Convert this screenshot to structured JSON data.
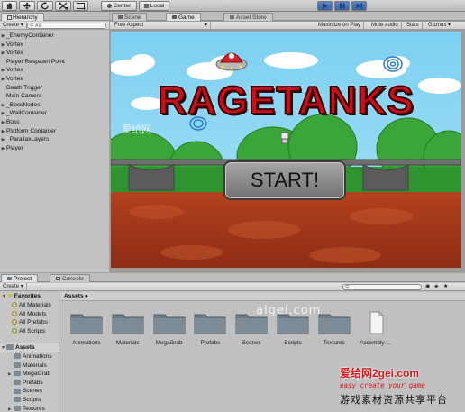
{
  "toolbar": {
    "pivot_label": "Center",
    "space_label": "Local"
  },
  "hierarchy": {
    "tab_label": "Hierarchy",
    "create_label": "Create",
    "search_placeholder": "All",
    "items": [
      {
        "label": "_EnemyContainer",
        "arrow": true
      },
      {
        "label": "Vortex",
        "arrow": true
      },
      {
        "label": "Vortex",
        "arrow": true
      },
      {
        "label": "Player Respawn Point",
        "arrow": false
      },
      {
        "label": "Vortex",
        "arrow": true
      },
      {
        "label": "Vortex",
        "arrow": true
      },
      {
        "label": "Death Trigger",
        "arrow": false
      },
      {
        "label": "Main Camera",
        "arrow": false
      },
      {
        "label": "_BossNodes",
        "arrow": true
      },
      {
        "label": "_WallContainer",
        "arrow": true
      },
      {
        "label": "Boss",
        "arrow": true
      },
      {
        "label": "Platform Container",
        "arrow": true
      },
      {
        "label": "_ParallaxLayers",
        "arrow": true
      },
      {
        "label": "Player",
        "arrow": true
      }
    ]
  },
  "center_tabs": {
    "scene": "Scene",
    "game": "Game",
    "asset_store": "Asset Store"
  },
  "game_bar": {
    "aspect": "Free Aspect",
    "maximize": "Maximize on Play",
    "mute": "Mute audio",
    "stats": "Stats",
    "gizmos": "Gizmos"
  },
  "game": {
    "logo": "RAGETANKS",
    "start_label": "START!",
    "watermark_small": "爱给网"
  },
  "project": {
    "tab_project": "Project",
    "tab_console": "Console",
    "create_label": "Create",
    "breadcrumb": "Assets",
    "favorites_label": "Favorites",
    "favorites": [
      "All Materials",
      "All Models",
      "All Prefabs",
      "All Scripts"
    ],
    "assets_label": "Assets",
    "tree": [
      "Animations",
      "Materials",
      "MegaGrab",
      "Prefabs",
      "Scenes",
      "Scripts",
      "Textures"
    ],
    "grid": [
      "Animations",
      "Materials",
      "MegaGrab",
      "Prefabs",
      "Scenes",
      "Scripts",
      "Textures",
      "Assembly-..."
    ]
  },
  "watermarks": {
    "site": "aigei.com",
    "brand": "爱给网2gei.com",
    "slogan": "easy create your game",
    "tagline": "游戏素材资源共享平台"
  },
  "colors": {
    "play_accent": "#3f6fb8",
    "sky": "#8fd3f0",
    "lava": "#a5361b",
    "logo_red": "#c8101a",
    "watermark_red": "#d8141a"
  }
}
